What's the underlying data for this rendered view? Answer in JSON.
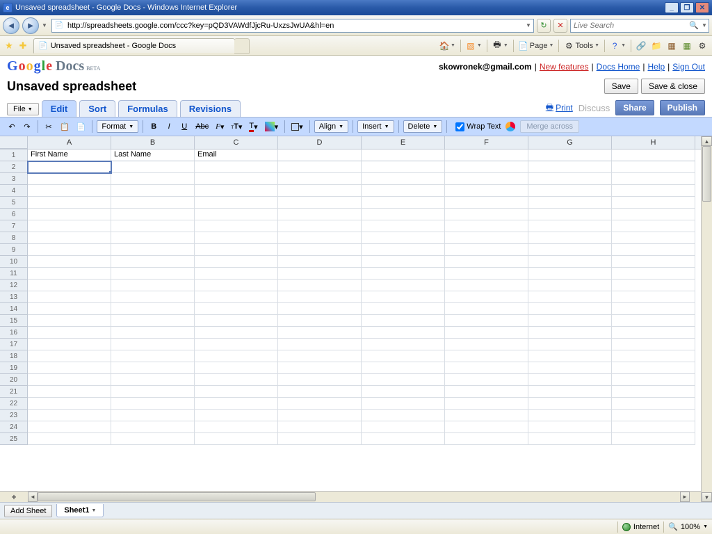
{
  "window": {
    "title": "Unsaved spreadsheet - Google Docs - Windows Internet Explorer"
  },
  "browser": {
    "url": "http://spreadsheets.google.com/ccc?key=pQD3VAWdfJjcRu-UxzsJwUA&hl=en",
    "search_placeholder": "Live Search",
    "tab_title": "Unsaved spreadsheet - Google Docs",
    "cmd": {
      "page": "Page",
      "tools": "Tools"
    },
    "status_zone": "Internet",
    "zoom": "100%"
  },
  "logo": {
    "brand": "Google",
    "product": "Docs",
    "beta": "BETA"
  },
  "account": {
    "email": "skowronek@gmail.com",
    "new_features": "New features",
    "docs_home": "Docs Home",
    "help": "Help",
    "sign_out": "Sign Out"
  },
  "doc": {
    "title": "Unsaved spreadsheet",
    "save": "Save",
    "save_close": "Save & close"
  },
  "tabs": {
    "file": "File",
    "edit": "Edit",
    "sort": "Sort",
    "formulas": "Formulas",
    "revisions": "Revisions",
    "print": "Print",
    "discuss": "Discuss",
    "share": "Share",
    "publish": "Publish"
  },
  "toolbar": {
    "format": "Format",
    "align": "Align",
    "insert": "Insert",
    "delete": "Delete",
    "wrap": "Wrap Text",
    "merge": "Merge across"
  },
  "sheet": {
    "columns": [
      "A",
      "B",
      "C",
      "D",
      "E",
      "F",
      "G",
      "H"
    ],
    "row_count": 25,
    "selected_cell": "A2",
    "data": {
      "1": {
        "A": "First Name",
        "B": "Last Name",
        "C": "Email"
      }
    },
    "add_sheet": "Add Sheet",
    "tab_name": "Sheet1"
  }
}
